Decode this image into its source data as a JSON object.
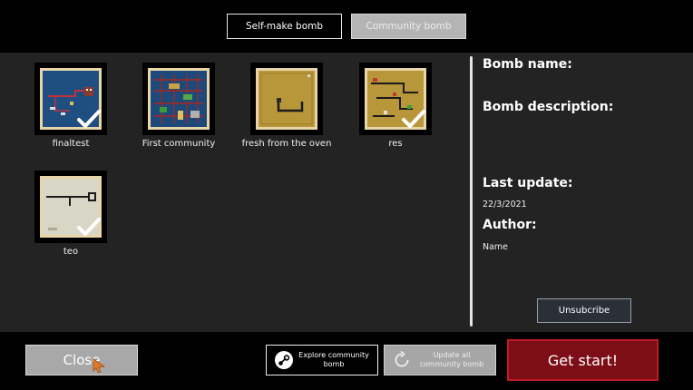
{
  "tabs": {
    "self_make": "Self-make bomb",
    "community": "Community bomb"
  },
  "bombs": [
    {
      "name": "finaltest",
      "selected": true
    },
    {
      "name": "First community",
      "selected": false
    },
    {
      "name": "fresh from the oven",
      "selected": false
    },
    {
      "name": "res",
      "selected": true
    },
    {
      "name": "teo",
      "selected": true
    }
  ],
  "details": {
    "name_label": "Bomb name:",
    "description_label": "Bomb description:",
    "last_update_label": "Last update:",
    "last_update_value": "22/3/2021",
    "author_label": "Author:",
    "author_value": "Name",
    "unsubscribe_label": "Unsubcribe"
  },
  "footer": {
    "close_label": "Close",
    "explore_label_line1": "Explore community",
    "explore_label_line2": "bomb",
    "update_label_line1": "Update all",
    "update_label_line2": "community bomb",
    "start_label": "Get start!"
  },
  "colors": {
    "panel_bg": "#232323",
    "start_button": "#7d0d16",
    "start_border": "#c01a24",
    "cursor": "#e07a2a"
  }
}
